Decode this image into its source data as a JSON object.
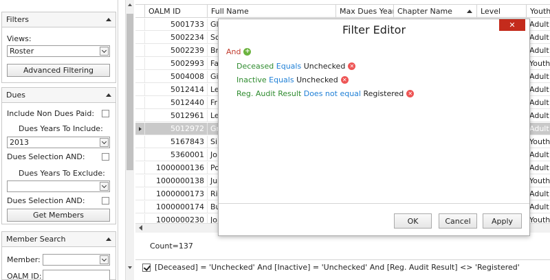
{
  "filters_panel": {
    "title": "Filters",
    "views_label": "Views:",
    "views_value": "Roster",
    "advanced_filtering_label": "Advanced Filtering"
  },
  "dues_panel": {
    "title": "Dues",
    "include_non_dues_paid_label": "Include Non Dues Paid:",
    "dues_years_include_label": "Dues Years To Include:",
    "dues_years_include_value": "2013",
    "dues_selection_and_label_1": "Dues Selection AND:",
    "dues_years_exclude_label": "Dues Years To Exclude:",
    "dues_years_exclude_value": "",
    "dues_selection_and_label_2": "Dues Selection AND:",
    "get_members_label": "Get Members"
  },
  "member_search_panel": {
    "title": "Member Search",
    "member_label": "Member:",
    "member_value": "",
    "oalm_id_label": "OALM ID:"
  },
  "grid": {
    "columns": [
      "OALM ID",
      "Full Name",
      "Max Dues Year",
      "Chapter Name",
      "Level",
      "Youth"
    ],
    "rows": [
      {
        "id": "5001733",
        "name": "Gl",
        "level": "Adult"
      },
      {
        "id": "5002234",
        "name": "Sc",
        "level": "Adult"
      },
      {
        "id": "5002239",
        "name": "Br",
        "level": "Adult"
      },
      {
        "id": "5002993",
        "name": "Fa",
        "level": "Youth"
      },
      {
        "id": "5004008",
        "name": "Gi",
        "level": "Adult"
      },
      {
        "id": "5012414",
        "name": "Le",
        "level": "Adult"
      },
      {
        "id": "5012440",
        "name": "Fr",
        "level": "Adult"
      },
      {
        "id": "5012961",
        "name": "Le",
        "level": "Adult"
      },
      {
        "id": "5012972",
        "name": "Gr",
        "level": "Adult"
      },
      {
        "id": "5167843",
        "name": "Si",
        "level": "Youth"
      },
      {
        "id": "5360001",
        "name": "Jo",
        "level": "Adult"
      },
      {
        "id": "1000000136",
        "name": "Po",
        "level": "Adult"
      },
      {
        "id": "1000000138",
        "name": "Ju",
        "level": "Youth"
      },
      {
        "id": "1000000173",
        "name": "Ri",
        "level": "Adult"
      },
      {
        "id": "1000000174",
        "name": "Bu",
        "level": "Adult"
      },
      {
        "id": "1000000230",
        "name": "Jo",
        "level": "Youth"
      }
    ],
    "selected_row": 8,
    "count_text": "Count=137"
  },
  "filter_bar": {
    "expression": "[Deceased] = 'Unchecked' And [Inactive] = 'Unchecked' And [Reg. Audit Result] <> 'Registered'"
  },
  "dialog": {
    "title": "Filter Editor",
    "close_label": "✕",
    "group_op": "And",
    "conditions": [
      {
        "field": "Deceased",
        "op": "Equals",
        "value": "Unchecked"
      },
      {
        "field": "Inactive",
        "op": "Equals",
        "value": "Unchecked"
      },
      {
        "field": "Reg. Audit Result",
        "op": "Does not equal",
        "value": "Registered"
      }
    ],
    "ok_label": "OK",
    "cancel_label": "Cancel",
    "apply_label": "Apply"
  },
  "colors": {
    "close_red": "#c42b1c",
    "group_red": "#c0392b",
    "field_green": "#2e8b2e",
    "operator_blue": "#1e7fd6",
    "selected_row": "#c9c9c9"
  }
}
